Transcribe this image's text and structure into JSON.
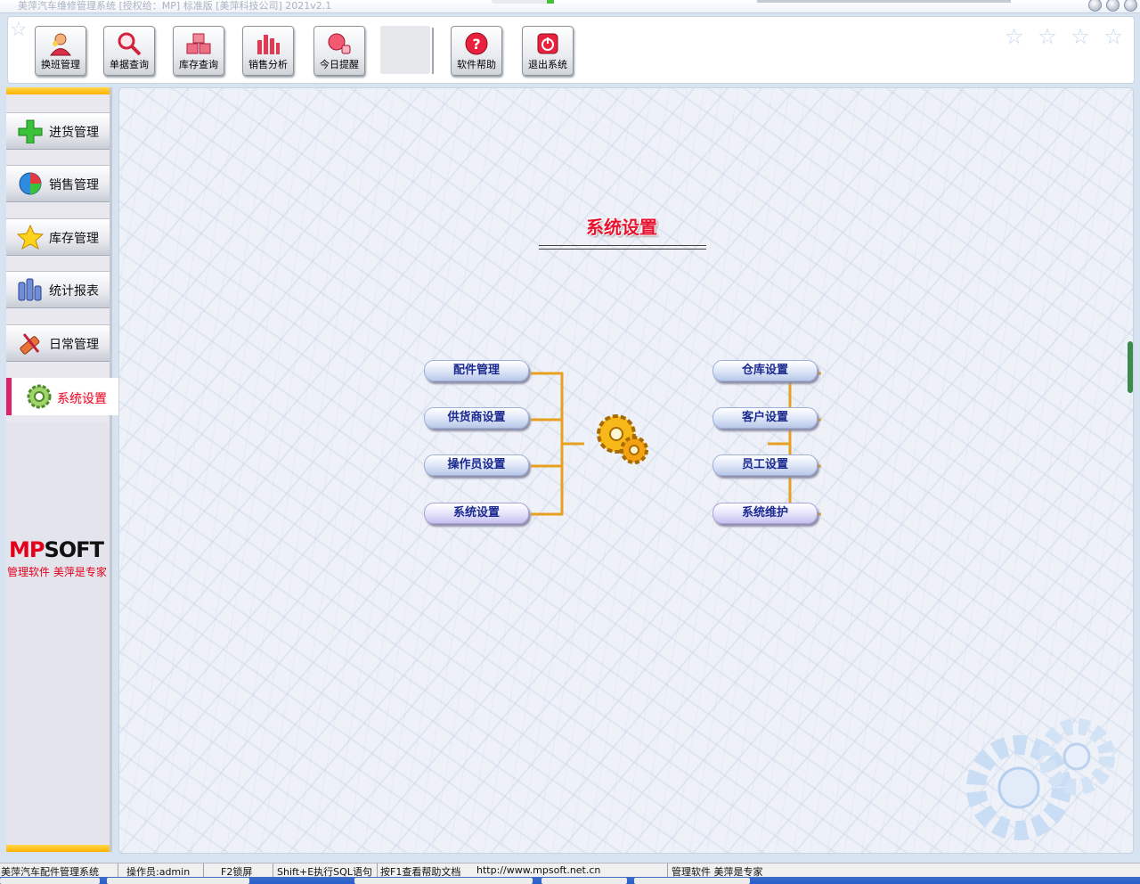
{
  "window": {
    "title": "美萍汽车维修管理系统 [授权给：MP] 标准版 [美萍科技公司] 2021v2.1"
  },
  "toolbar": {
    "buttons": [
      {
        "label": "换班管理",
        "icon": "shift-user-icon"
      },
      {
        "label": "单据查询",
        "icon": "magnifier-icon"
      },
      {
        "label": "库存查询",
        "icon": "boxes-icon"
      },
      {
        "label": "销售分析",
        "icon": "bar-chart-icon"
      },
      {
        "label": "今日提醒",
        "icon": "bell-icon"
      },
      {
        "label": "软件帮助",
        "icon": "help-icon"
      },
      {
        "label": "退出系统",
        "icon": "power-icon"
      }
    ]
  },
  "sidebar": {
    "items": [
      {
        "label": "进货管理",
        "icon": "plus-icon"
      },
      {
        "label": "销售管理",
        "icon": "pie-icon"
      },
      {
        "label": "库存管理",
        "icon": "star-icon"
      },
      {
        "label": "统计报表",
        "icon": "report-icon"
      },
      {
        "label": "日常管理",
        "icon": "tools-icon"
      }
    ],
    "selected": {
      "label": "系统设置",
      "icon": "gear-icon"
    },
    "brand": {
      "mp": "MP",
      "soft": "SOFT",
      "slogan": "管理软件 美萍是专家"
    }
  },
  "main": {
    "title": "系统设置",
    "left_buttons": [
      "配件管理",
      "供货商设置",
      "操作员设置",
      "系统设置"
    ],
    "right_buttons": [
      "仓库设置",
      "客户设置",
      "员工设置",
      "系统维护"
    ],
    "center_icon": "gears-icon",
    "connector_color": "#e8a020"
  },
  "status": {
    "app": "美萍汽车配件管理系统",
    "operator": "操作员:admin",
    "lock": "F2锁屏",
    "sql": "Shift+E执行SQL语句",
    "help": "按F1查看帮助文档",
    "url": "http://www.mpsoft.net.cn",
    "slogan": "管理软件 美萍是专家"
  }
}
